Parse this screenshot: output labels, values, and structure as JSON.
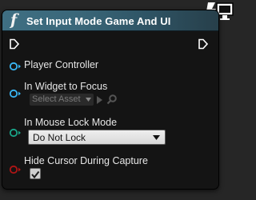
{
  "node": {
    "title": "Set Input Mode Game And UI",
    "function_icon": "f",
    "header_color": "#3a6779"
  },
  "pins": {
    "player_controller": {
      "label": "Player Controller",
      "color": "#39b7f5"
    },
    "in_widget_to_focus": {
      "label": "In Widget to Focus",
      "color": "#39b7f5",
      "asset_placeholder": "Select Asset"
    },
    "in_mouse_lock_mode": {
      "label": "In Mouse Lock Mode",
      "color": "#1aa68a",
      "selected_value": "Do Not Lock"
    },
    "hide_cursor_during_capture": {
      "label": "Hide Cursor During Capture",
      "color": "#b01515",
      "checked": true
    }
  },
  "icons": [
    "exec-in-icon",
    "exec-out-icon",
    "function-icon",
    "use-selected-arrow-icon",
    "browse-magnifier-icon",
    "dropdown-caret-icon",
    "checkmark-icon",
    "not-replicated-monitor-icon"
  ]
}
